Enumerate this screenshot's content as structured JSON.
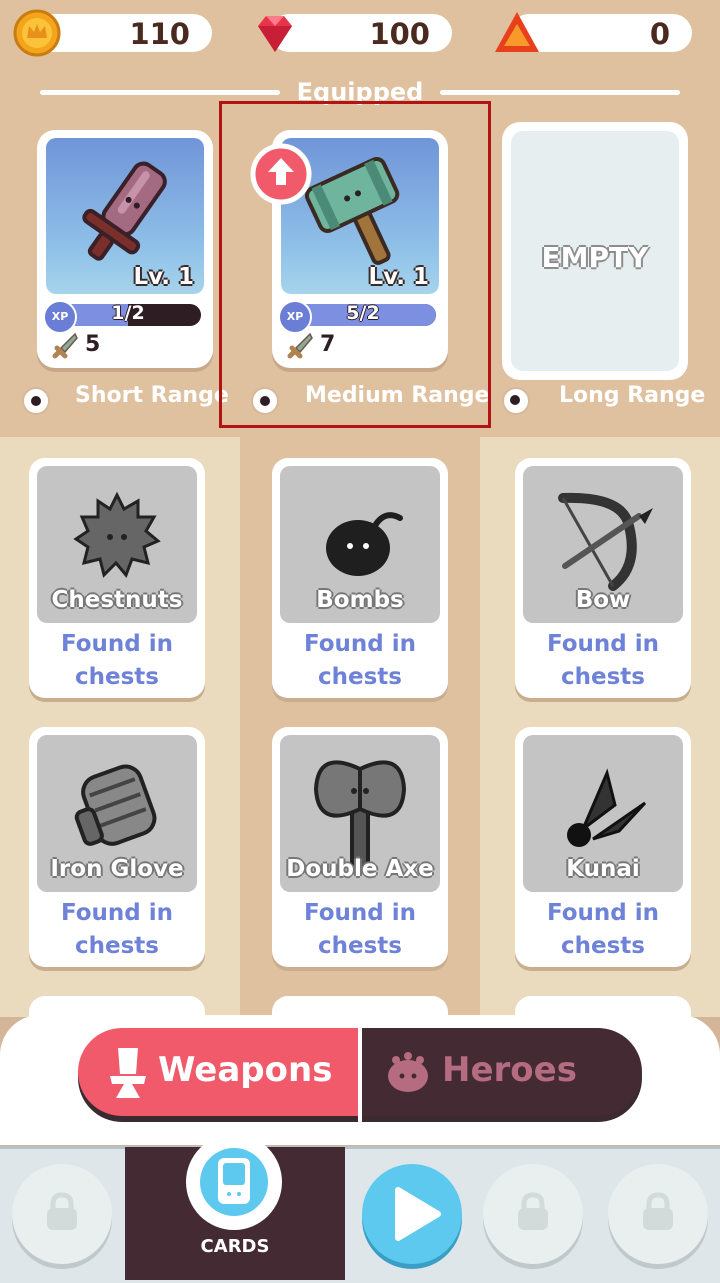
{
  "currency": {
    "coins": "110",
    "gems": "100",
    "tokens": "0"
  },
  "equipped": {
    "title": "Equipped",
    "slots": [
      {
        "level": "Lv. 1",
        "xp_text": "1/2",
        "xp_fraction": 0.5,
        "xp_badge": "XP",
        "attack": "5",
        "range_label": "Short Range",
        "weapon_icon": "sword-icon"
      },
      {
        "level": "Lv. 1",
        "xp_text": "5/2",
        "xp_fraction": 1.0,
        "xp_badge": "XP",
        "attack": "7",
        "range_label": "Medium Range",
        "weapon_icon": "hammer-icon",
        "upgrade_available": true
      },
      {
        "empty_label": "EMPTY",
        "range_label": "Long Range"
      }
    ]
  },
  "weapons": [
    {
      "name": "Chestnuts",
      "status_line1": "Found in",
      "status_line2": "chests",
      "icon": "chestnut-icon"
    },
    {
      "name": "Bombs",
      "status_line1": "Found in",
      "status_line2": "chests",
      "icon": "bomb-icon"
    },
    {
      "name": "Bow",
      "status_line1": "Found in",
      "status_line2": "chests",
      "icon": "bow-icon"
    },
    {
      "name": "Iron Glove",
      "status_line1": "Found in",
      "status_line2": "chests",
      "icon": "iron-glove-icon"
    },
    {
      "name": "Double Axe",
      "status_line1": "Found in",
      "status_line2": "chests",
      "icon": "double-axe-icon"
    },
    {
      "name": "Kunai",
      "status_line1": "Found in",
      "status_line2": "chests",
      "icon": "kunai-icon"
    }
  ],
  "tabs": {
    "weapons_label": "Weapons",
    "heroes_label": "Heroes",
    "active": "Weapons"
  },
  "nav": {
    "cards_label": "CARDS"
  },
  "colors": {
    "accent_red": "#f05a6a",
    "dark": "#442a33",
    "xp_blue": "#7d8fe0",
    "play_blue": "#5ec9ef"
  }
}
